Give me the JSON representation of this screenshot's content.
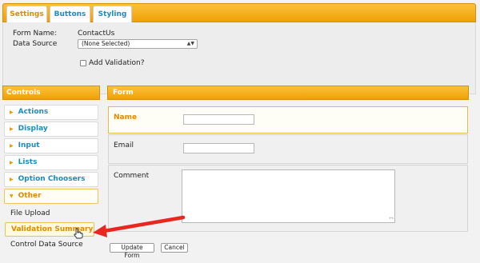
{
  "tabs": [
    {
      "label": "Settings",
      "active": true
    },
    {
      "label": "Buttons",
      "active": false
    },
    {
      "label": "Styling",
      "active": false
    }
  ],
  "settings": {
    "form_name_label": "Form Name:",
    "form_name_value": "ContactUs",
    "data_source_label": "Data Source",
    "data_source_value": "(None Selected)",
    "add_validation_label": "Add Validation?",
    "add_validation_checked": false
  },
  "controls": {
    "header": "Controls",
    "categories": [
      {
        "label": "Actions",
        "expanded": false
      },
      {
        "label": "Display",
        "expanded": false
      },
      {
        "label": "Input",
        "expanded": false
      },
      {
        "label": "Lists",
        "expanded": false
      },
      {
        "label": "Option Choosers",
        "expanded": false
      },
      {
        "label": "Other",
        "expanded": true
      }
    ],
    "other_items": [
      "File Upload",
      "Validation Summary",
      "Control Data Source"
    ],
    "highlighted_item": "Validation Summary"
  },
  "form": {
    "header": "Form",
    "fields": [
      {
        "label": "Name",
        "type": "text",
        "selected": true
      },
      {
        "label": "Email",
        "type": "text",
        "selected": false
      },
      {
        "label": "Comment",
        "type": "textarea",
        "selected": false
      }
    ],
    "update_button": "Update Form",
    "cancel_button": "Cancel"
  },
  "colors": {
    "accent_orange": "#f0a007",
    "link_blue": "#1a8bc4",
    "arrow_red": "#e8281e"
  },
  "icons": [
    "triangle-right-icon",
    "triangle-down-icon",
    "hand-pointer-cursor-icon",
    "red-arrow-icon",
    "chevron-updown-icon",
    "resize-grip-icon"
  ]
}
